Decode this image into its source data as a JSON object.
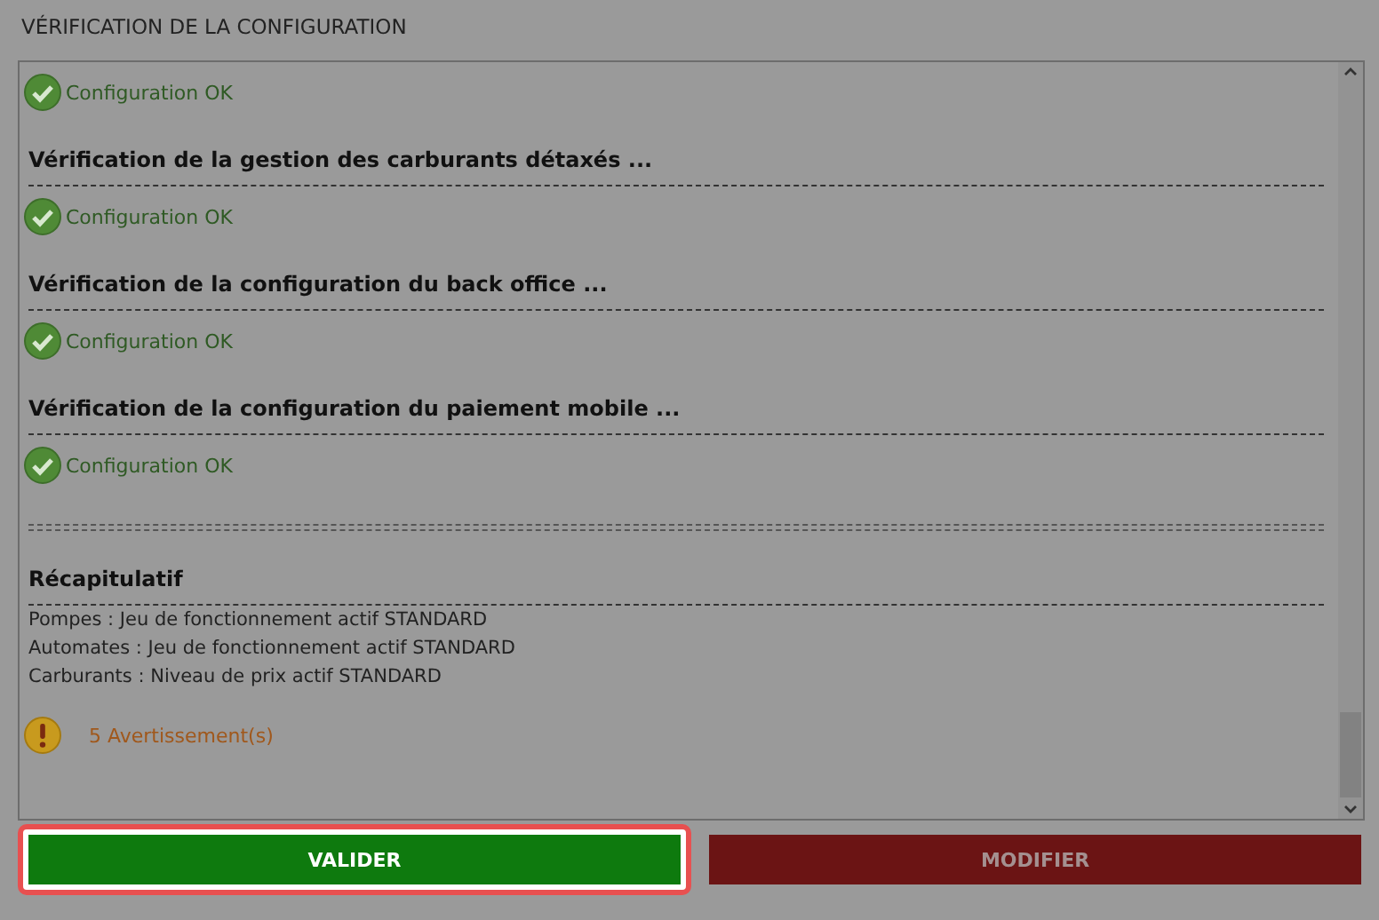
{
  "dialog": {
    "title": "VÉRIFICATION DE LA CONFIGURATION"
  },
  "log": [
    {
      "kind": "ok",
      "text": "Configuration OK"
    },
    {
      "kind": "heading",
      "text": "Vérification de la gestion des carburants détaxés ..."
    },
    {
      "kind": "rule"
    },
    {
      "kind": "ok",
      "text": "Configuration OK"
    },
    {
      "kind": "heading",
      "text": "Vérification de la configuration du back office ..."
    },
    {
      "kind": "rule"
    },
    {
      "kind": "ok",
      "text": "Configuration OK"
    },
    {
      "kind": "heading",
      "text": "Vérification de la configuration du paiement mobile ..."
    },
    {
      "kind": "rule"
    },
    {
      "kind": "ok",
      "text": "Configuration OK"
    },
    {
      "kind": "double-rule"
    },
    {
      "kind": "heading",
      "text": "Récapitulatif"
    },
    {
      "kind": "rule"
    },
    {
      "kind": "text",
      "text": "Pompes : Jeu de fonctionnement actif STANDARD"
    },
    {
      "kind": "text",
      "text": "Automates : Jeu de fonctionnement actif STANDARD"
    },
    {
      "kind": "text",
      "text": "Carburants : Niveau de prix actif STANDARD"
    },
    {
      "kind": "warning",
      "text": "5 Avertissement(s)"
    }
  ],
  "buttons": [
    {
      "label": "VALIDER",
      "kind": "confirm",
      "highlighted": true
    },
    {
      "label": "MODIFIER",
      "kind": "cancel",
      "highlighted": false
    }
  ]
}
